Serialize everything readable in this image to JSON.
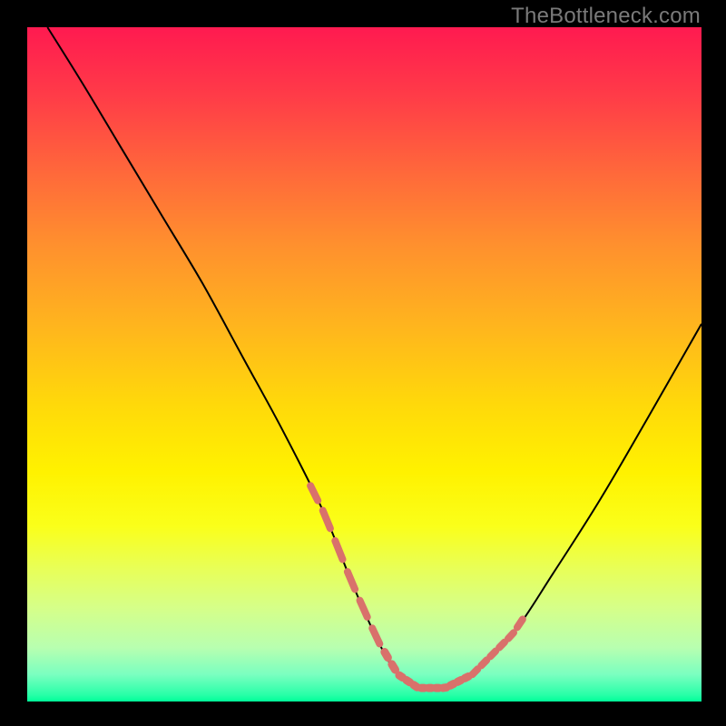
{
  "watermark": "TheBottleneck.com",
  "chart_data": {
    "type": "line",
    "title": "",
    "xlabel": "",
    "ylabel": "",
    "xlim": [
      0,
      100
    ],
    "ylim": [
      0,
      100
    ],
    "grid": false,
    "series": [
      {
        "name": "curve",
        "color": "#000000",
        "x": [
          3,
          8,
          14,
          20,
          26,
          32,
          38,
          44,
          48,
          52,
          55,
          58,
          62,
          66,
          72,
          78,
          85,
          92,
          100
        ],
        "y": [
          100,
          92,
          82,
          72,
          62,
          51,
          40,
          28,
          18,
          9,
          4,
          2,
          2,
          4,
          10,
          19,
          30,
          42,
          56
        ]
      }
    ],
    "markers": [
      {
        "name": "left-dashes",
        "color": "#d9716b",
        "x_range": [
          42,
          53
        ],
        "style": "dashed"
      },
      {
        "name": "valley-dashes",
        "color": "#d9716b",
        "x_range": [
          53,
          66
        ],
        "style": "dotted-heavy"
      },
      {
        "name": "right-dashes",
        "color": "#d9716b",
        "x_range": [
          66,
          74
        ],
        "style": "dashed"
      }
    ]
  }
}
